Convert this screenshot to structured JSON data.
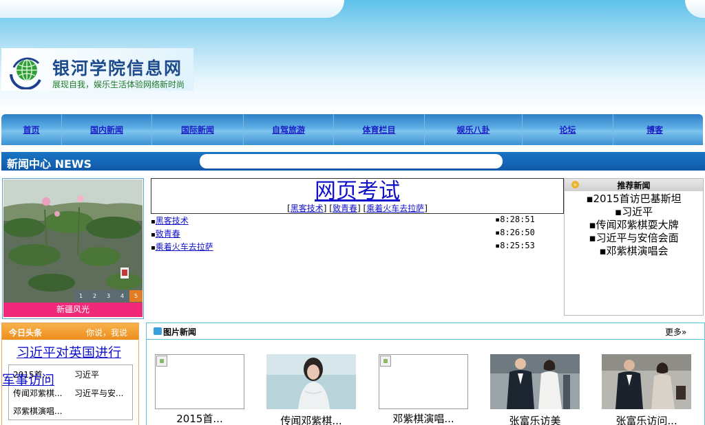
{
  "header": {
    "site_title": "银河学院信息网",
    "slogan": "展现自我，娱乐生活体验网络新时尚"
  },
  "nav": {
    "items": [
      {
        "label": "首页"
      },
      {
        "label": "国内新闻"
      },
      {
        "label": "国际新闻"
      },
      {
        "label": "自驾旅游"
      },
      {
        "label": "体育栏目"
      },
      {
        "label": "娱乐八卦"
      },
      {
        "label": "论坛"
      },
      {
        "label": "博客"
      }
    ]
  },
  "news_bar": {
    "title": "新闻中心 NEWS",
    "search_value": ""
  },
  "slider": {
    "numbers": [
      "1",
      "2",
      "3",
      "4",
      "5"
    ],
    "active_index": 4,
    "caption": "新疆风光"
  },
  "main_news": {
    "headline": "网页考试",
    "headline_links": [
      "黑客技术",
      "致青春",
      "乘着火车去拉萨"
    ],
    "rows": [
      {
        "title": "黑客技术",
        "time": "8:28:51"
      },
      {
        "title": "致青春",
        "time": "8:26:50"
      },
      {
        "title": "乘着火车去拉萨",
        "time": "8:25:53"
      }
    ]
  },
  "recommend": {
    "title": "推荐新闻",
    "items": [
      "▪2015首访巴基斯坦",
      "▪习近平",
      "▪传闻邓紫棋耍大牌",
      "▪习近平与安倍会面",
      "▪邓紫棋演唱会"
    ]
  },
  "today": {
    "title": "今日头条",
    "extra": "你说，我说",
    "main_headline": "习近平对英国进行",
    "main_headline_overflow": "军事访问",
    "grid": [
      "2015首...",
      "习近平",
      "传闻邓紫棋...",
      "习近平与安...",
      "邓紫棋演唱..."
    ]
  },
  "pic_news": {
    "title": "图片新闻",
    "more": "更多»",
    "items": [
      {
        "caption": "2015首...",
        "image": "broken"
      },
      {
        "caption": "传闻邓紫棋...",
        "image": "woman-portrait"
      },
      {
        "caption": "邓紫棋演唱...",
        "image": "broken"
      },
      {
        "caption": "张富乐访美",
        "image": "couple-walking"
      },
      {
        "caption": "张富乐访问...",
        "image": "couple-airport"
      }
    ]
  },
  "colors": {
    "link": "#1111cc",
    "nav_gradient": "#3b91d3",
    "news_bar": "#1a74c4",
    "slider_caption": "#f0297a",
    "today_head": "#ee8e1e"
  }
}
